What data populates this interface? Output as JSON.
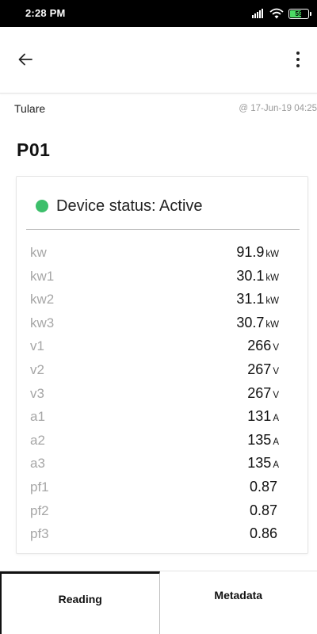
{
  "status_bar": {
    "time": "2:28 PM",
    "battery": "59",
    "icons": [
      "signal-icon",
      "wifi-icon",
      "battery-icon"
    ]
  },
  "app_bar": {
    "back_icon": "arrow-left-icon",
    "menu_icon": "more-vert-icon"
  },
  "location": {
    "name": "Tulare",
    "timestamp": "@ 17-Jun-19 04:25"
  },
  "device": {
    "title": "P01",
    "status_label": "Device status: Active",
    "status_color": "#3dbf6b"
  },
  "readings": [
    {
      "label": "kw",
      "value": "91.9",
      "unit": "kW"
    },
    {
      "label": "kw1",
      "value": "30.1",
      "unit": "kW"
    },
    {
      "label": "kw2",
      "value": "31.1",
      "unit": "kW"
    },
    {
      "label": "kw3",
      "value": "30.7",
      "unit": "kW"
    },
    {
      "label": "v1",
      "value": "266",
      "unit": "V"
    },
    {
      "label": "v2",
      "value": "267",
      "unit": "V"
    },
    {
      "label": "v3",
      "value": "267",
      "unit": "V"
    },
    {
      "label": "a1",
      "value": "131",
      "unit": "A"
    },
    {
      "label": "a2",
      "value": "135",
      "unit": "A"
    },
    {
      "label": "a3",
      "value": "135",
      "unit": "A"
    },
    {
      "label": "pf1",
      "value": "0.87",
      "unit": ""
    },
    {
      "label": "pf2",
      "value": "0.87",
      "unit": ""
    },
    {
      "label": "pf3",
      "value": "0.86",
      "unit": ""
    }
  ],
  "tabs": [
    {
      "label": "Reading",
      "active": true
    },
    {
      "label": "Metadata",
      "active": false
    }
  ]
}
